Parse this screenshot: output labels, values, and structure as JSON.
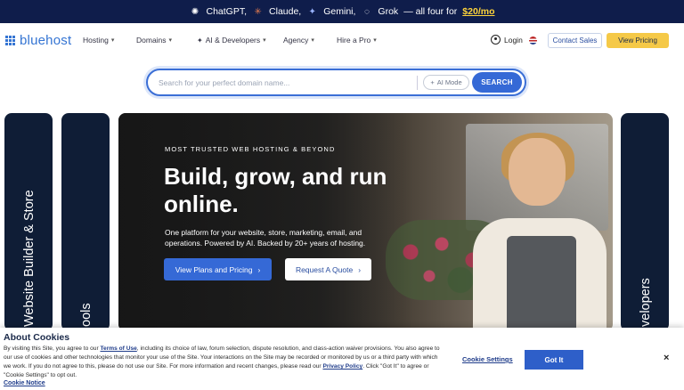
{
  "promo": {
    "items": [
      {
        "icon": "chatgpt-icon",
        "label": "ChatGPT,"
      },
      {
        "icon": "claude-icon",
        "label": "Claude,"
      },
      {
        "icon": "gemini-icon",
        "label": "Gemini,"
      },
      {
        "icon": "grok-icon",
        "label": "Grok"
      }
    ],
    "tail": "— all four for",
    "price": "$20/mo"
  },
  "nav": {
    "logo": "bluehost",
    "menu": [
      "Hosting",
      "Domains",
      "AI & Developers",
      "Agency",
      "Hire a Pro"
    ],
    "login": "Login",
    "contact": "Contact Sales",
    "pricing": "View Pricing"
  },
  "search": {
    "placeholder": "Search for your perfect domain name...",
    "value": "",
    "ai_mode": "AI Mode",
    "button": "SEARCH"
  },
  "side_cards": {
    "left1": "Website Builder & Store",
    "left2": "ools",
    "right": "velopers"
  },
  "hero": {
    "eyebrow": "MOST TRUSTED WEB HOSTING & BEYOND",
    "headline": "Build, grow, and run online.",
    "sub": "One platform for your website, store, marketing, email, and operations. Powered by AI. Backed by 20+ years of hosting.",
    "primary_cta": "View Plans and Pricing",
    "secondary_cta": "Request A Quote"
  },
  "cookie": {
    "title": "About Cookies",
    "p1": "By visiting this Site, you agree to our ",
    "terms": "Terms of Use",
    "p2": ", including its choice of law, forum selection, dispute resolution, and class-action waiver provisions. You also agree to our use of cookies and other technologies that monitor your use of the Site. Your interactions on the Site may be recorded or monitored by us or a third party with which we work. If you do not agree to this, please do not use our Site. For more information and recent changes, please read our ",
    "privacy": "Privacy Policy",
    "p3": ". Click \"Got It\" to agree or \"Cookie Settings\" to opt out.",
    "notice": "Cookie Notice",
    "settings": "Cookie Settings",
    "got_it": "Got It",
    "close": "×"
  },
  "colors": {
    "promo_bg": "#0f1d4b",
    "brand_blue": "#3569d6",
    "pricing_yellow": "#f5c948",
    "card_navy": "#0f1d36"
  }
}
